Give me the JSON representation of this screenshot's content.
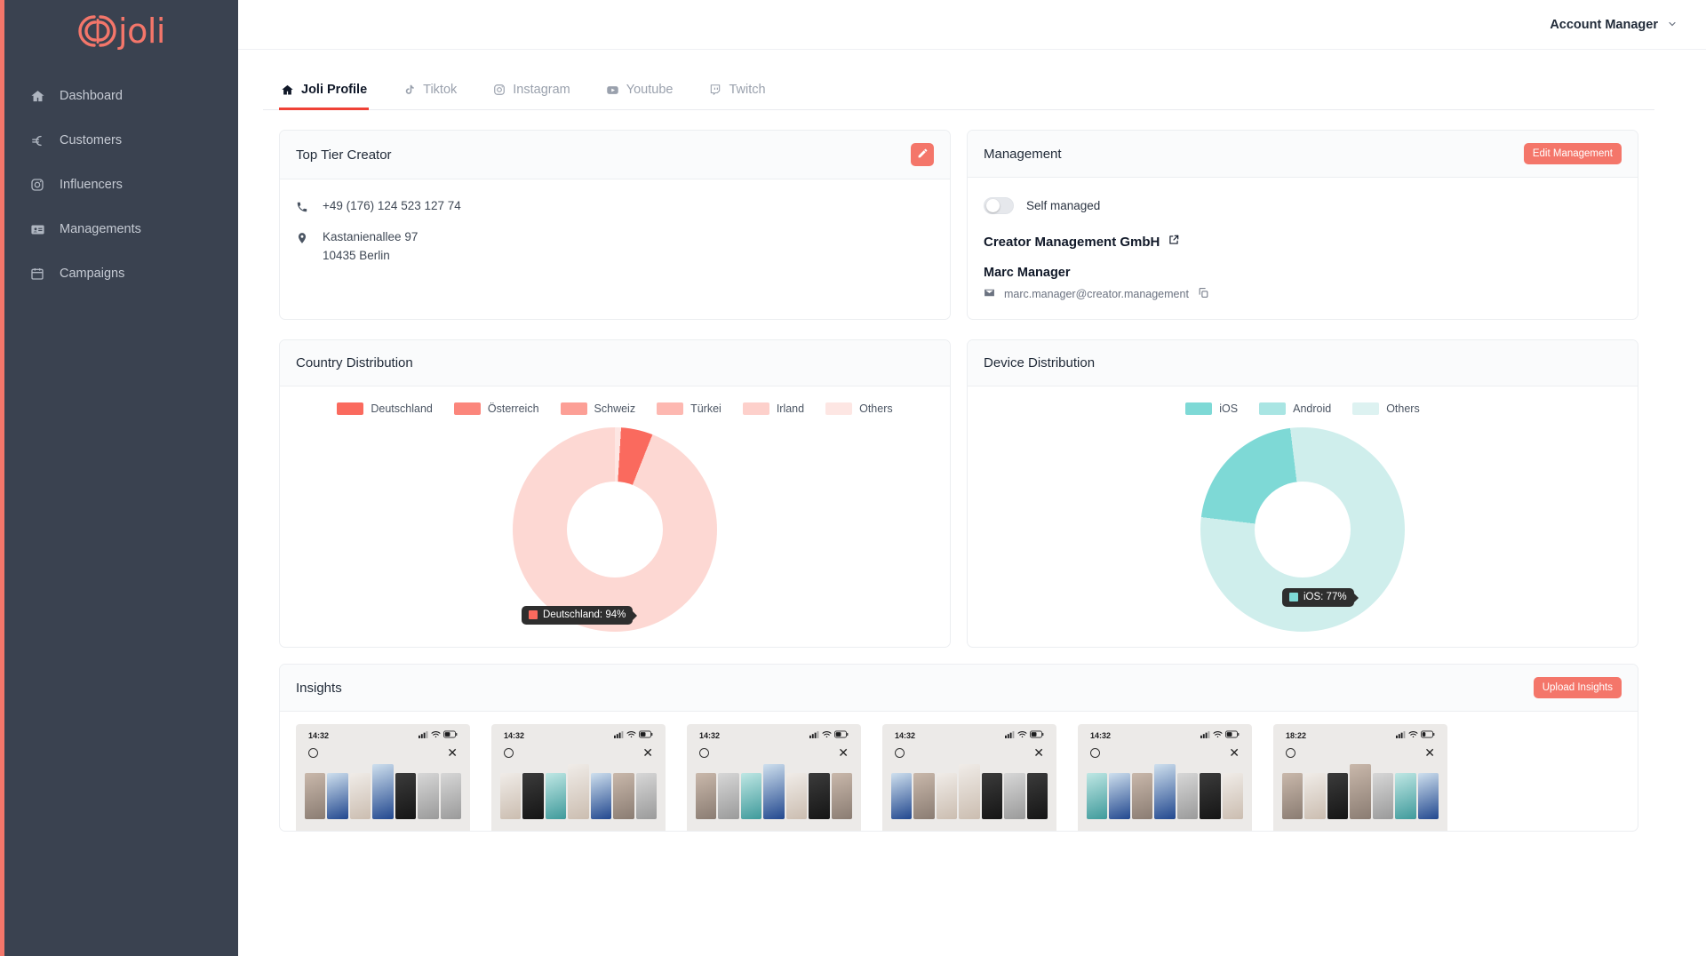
{
  "brand": {
    "name": "joli",
    "accent": "#f4766a"
  },
  "sidebar": {
    "items": [
      {
        "label": "Dashboard",
        "icon": "home-icon"
      },
      {
        "label": "Customers",
        "icon": "euro-icon"
      },
      {
        "label": "Influencers",
        "icon": "instagram-icon"
      },
      {
        "label": "Managements",
        "icon": "id-card-icon"
      },
      {
        "label": "Campaigns",
        "icon": "calendar-icon"
      }
    ]
  },
  "topbar": {
    "account_label": "Account Manager",
    "caret": "⌄"
  },
  "tabs": [
    {
      "label": "Joli Profile",
      "icon": "home-icon",
      "active": true
    },
    {
      "label": "Tiktok",
      "icon": "tiktok-icon",
      "active": false
    },
    {
      "label": "Instagram",
      "icon": "instagram-icon",
      "active": false
    },
    {
      "label": "Youtube",
      "icon": "youtube-icon",
      "active": false
    },
    {
      "label": "Twitch",
      "icon": "twitch-icon",
      "active": false
    }
  ],
  "profile_card": {
    "title": "Top Tier Creator",
    "edit_icon": "pencil-icon",
    "phone": "+49 (176) 124 523 127 74",
    "address_line1": "Kastanienallee 97",
    "address_line2": "10435 Berlin"
  },
  "management_card": {
    "title": "Management",
    "edit_button": "Edit Management",
    "self_managed_label": "Self managed",
    "self_managed_on": false,
    "company": "Creator Management GmbH",
    "company_link_icon": "external-link-icon",
    "manager_name": "Marc Manager",
    "manager_email": "marc.manager@creator.management",
    "copy_icon": "copy-icon"
  },
  "country_card": {
    "title": "Country Distribution",
    "tooltip": {
      "label": "Deutschland: 94%",
      "color": "#fa6a5e"
    }
  },
  "device_card": {
    "title": "Device Distribution",
    "tooltip": {
      "label": "iOS: 77%",
      "color": "#7ed9d6"
    }
  },
  "insights_card": {
    "title": "Insights",
    "upload_button": "Upload Insights",
    "shots": [
      {
        "time": "14:32"
      },
      {
        "time": "14:32"
      },
      {
        "time": "14:32"
      },
      {
        "time": "14:32"
      },
      {
        "time": "14:32"
      },
      {
        "time": "18:22"
      }
    ]
  },
  "chart_data": [
    {
      "type": "pie",
      "title": "Country Distribution",
      "legend_position": "top",
      "categories": [
        "Deutschland",
        "Österreich",
        "Schweiz",
        "Türkei",
        "Irland",
        "Others"
      ],
      "values": [
        94,
        2,
        1.5,
        1,
        0.8,
        0.7
      ],
      "unit": "%",
      "colors": [
        "#fa6a5e",
        "#fb867c",
        "#fc9f96",
        "#fdb8b1",
        "#fdd0cb",
        "#fde6e3"
      ],
      "annotations": [
        "Deutschland: 94%"
      ]
    },
    {
      "type": "pie",
      "title": "Device Distribution",
      "legend_position": "top",
      "categories": [
        "iOS",
        "Android",
        "Others"
      ],
      "values": [
        77,
        21,
        2
      ],
      "unit": "%",
      "colors": [
        "#7ed9d6",
        "#a9e5e3",
        "#ddf2f1"
      ],
      "annotations": [
        "iOS: 77%"
      ]
    }
  ]
}
